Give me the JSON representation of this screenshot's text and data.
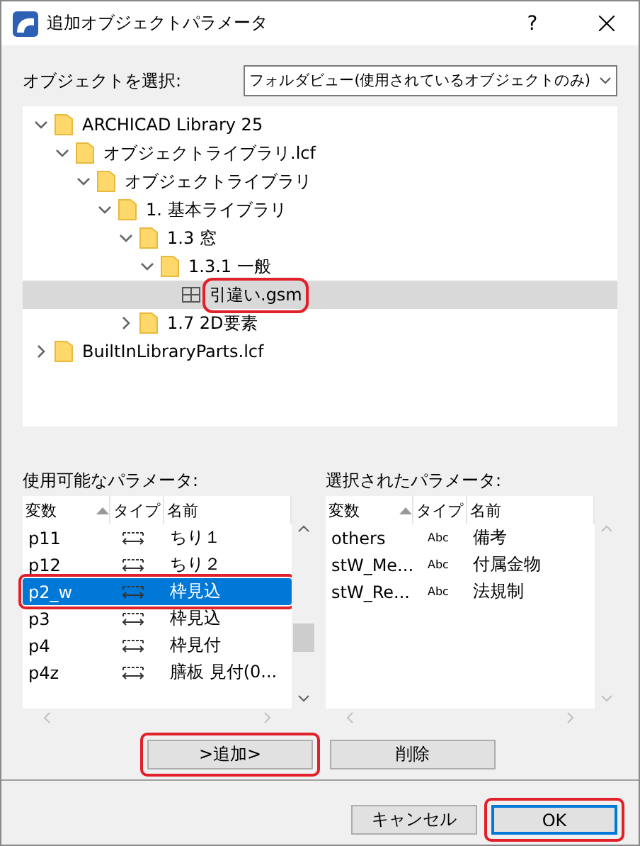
{
  "window": {
    "title": "追加オブジェクトパラメータ",
    "help": "?"
  },
  "object_select": {
    "label": "オブジェクトを選択:",
    "value": "フォルダビュー(使用されているオブジェクトのみ)"
  },
  "tree": [
    {
      "label": "ARCHICAD Library 25",
      "kind": "folder",
      "expanded": true,
      "selected": false,
      "children": [
        {
          "label": "オブジェクトライブラリ.lcf",
          "kind": "folder",
          "expanded": true,
          "selected": false,
          "children": [
            {
              "label": "オブジェクトライブラリ",
              "kind": "folder",
              "expanded": true,
              "selected": false,
              "children": [
                {
                  "label": "1. 基本ライブラリ",
                  "kind": "folder",
                  "expanded": true,
                  "selected": false,
                  "children": [
                    {
                      "label": "1.3 窓",
                      "kind": "folder",
                      "expanded": true,
                      "selected": false,
                      "children": [
                        {
                          "label": "1.3.1 一般",
                          "kind": "folder",
                          "expanded": true,
                          "selected": false,
                          "children": [
                            {
                              "label": "引違い.gsm",
                              "kind": "object",
                              "selected": true,
                              "highlighted": true
                            }
                          ]
                        }
                      ]
                    },
                    {
                      "label": "1.7 2D要素",
                      "kind": "folder",
                      "expanded": false,
                      "selected": false
                    }
                  ]
                }
              ]
            }
          ]
        }
      ]
    },
    {
      "label": "BuiltInLibraryParts.lcf",
      "kind": "folder",
      "expanded": false,
      "selected": false
    }
  ],
  "available": {
    "label": "使用可能なパラメータ:",
    "columns": [
      "変数",
      "タイプ",
      "名前"
    ],
    "rows": [
      {
        "variable": "p11",
        "type": {
          "kind": "length"
        },
        "name": "ちり１",
        "selected": false,
        "highlighted": false
      },
      {
        "variable": "p12",
        "type": {
          "kind": "length"
        },
        "name": "ちり２",
        "selected": false,
        "highlighted": false
      },
      {
        "variable": "p2_w",
        "type": {
          "kind": "length"
        },
        "name": "枠見込",
        "selected": true,
        "highlighted": true
      },
      {
        "variable": "p3",
        "type": {
          "kind": "length"
        },
        "name": "枠見込",
        "selected": false,
        "highlighted": false
      },
      {
        "variable": "p4",
        "type": {
          "kind": "length"
        },
        "name": "枠見付",
        "selected": false,
        "highlighted": false
      },
      {
        "variable": "p4z",
        "type": {
          "kind": "length"
        },
        "name": "膳板 見付(0...",
        "selected": false,
        "highlighted": false
      }
    ]
  },
  "chosen": {
    "label": "選択されたパラメータ:",
    "columns": [
      "変数",
      "タイプ",
      "名前"
    ],
    "rows": [
      {
        "variable": "others",
        "type": {
          "kind": "text",
          "label": "Abc"
        },
        "name": "備考",
        "selected": false,
        "highlighted": false
      },
      {
        "variable": "stW_Me...",
        "type": {
          "kind": "text",
          "label": "Abc"
        },
        "name": "付属金物",
        "selected": false,
        "highlighted": false
      },
      {
        "variable": "stW_Re...",
        "type": {
          "kind": "text",
          "label": "Abc"
        },
        "name": "法規制",
        "selected": false,
        "highlighted": false
      }
    ]
  },
  "list_buttons": [
    {
      "label": ">追加>",
      "highlighted": true
    },
    {
      "label": "削除",
      "highlighted": false
    }
  ],
  "dialog_buttons": [
    {
      "label": "キャンセル",
      "default": false,
      "highlighted": false
    },
    {
      "label": "OK",
      "default": true,
      "highlighted": true
    }
  ]
}
